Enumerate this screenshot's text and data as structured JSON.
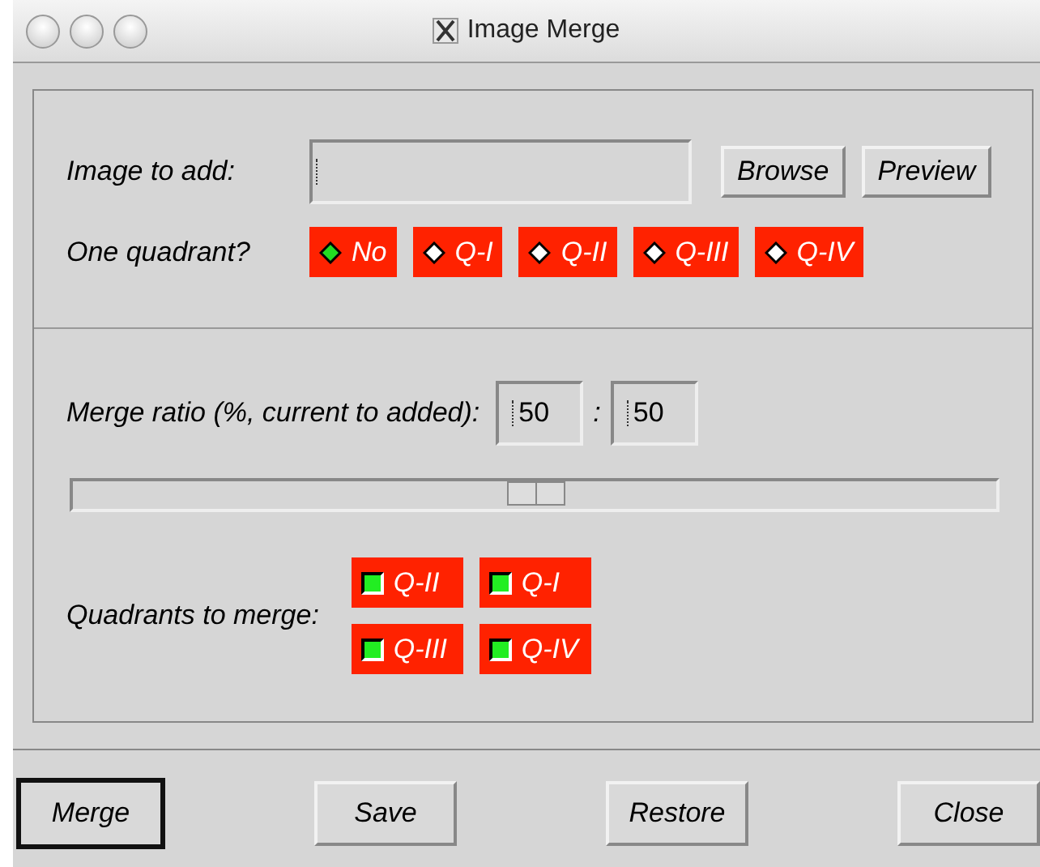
{
  "window": {
    "title": "Image Merge"
  },
  "image_to_add": {
    "label": "Image to add:"
  },
  "top_buttons": [
    "Browse",
    "Preview"
  ],
  "one_quadrant": {
    "label": "One quadrant?",
    "options": [
      {
        "label": "No",
        "selected": true
      },
      {
        "label": "Q-I",
        "selected": false
      },
      {
        "label": "Q-II",
        "selected": false
      },
      {
        "label": "Q-III",
        "selected": false
      },
      {
        "label": "Q-IV",
        "selected": false
      }
    ]
  },
  "merge_ratio": {
    "label": "Merge ratio (%, current to added):",
    "current": "50",
    "separator": ":",
    "added": "50",
    "level": 0.5
  },
  "quadrants_to_merge": {
    "label": "Quadrants to merge:",
    "options": [
      {
        "label": "Q-II",
        "checked": true
      },
      {
        "label": "Q-I",
        "checked": true
      },
      {
        "label": "Q-III",
        "checked": true
      },
      {
        "label": "Q-IV",
        "checked": true
      }
    ]
  },
  "buttons": [
    {
      "label": "Merge",
      "default": true
    },
    {
      "label": "Save",
      "default": false
    },
    {
      "label": "Restore",
      "default": false
    },
    {
      "label": "Close",
      "default": false
    }
  ]
}
